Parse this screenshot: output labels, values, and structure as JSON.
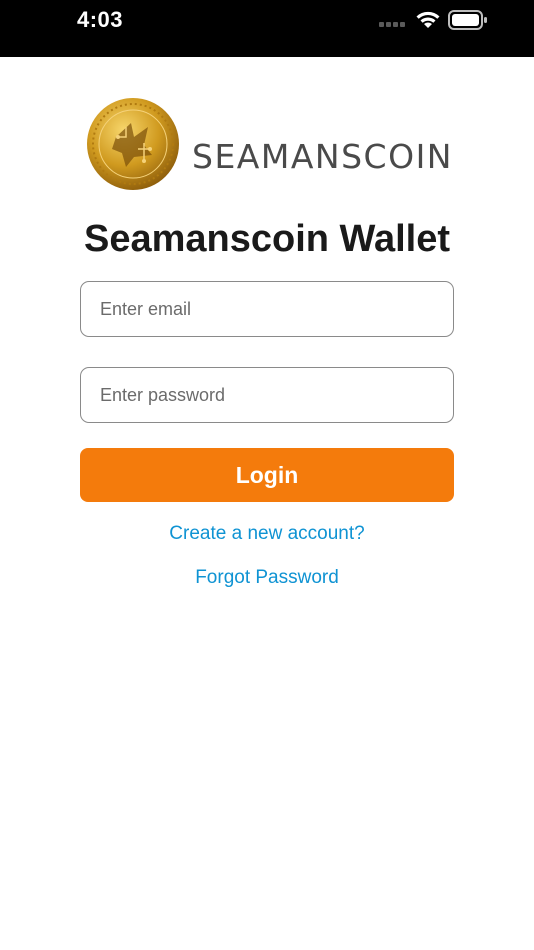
{
  "status_bar": {
    "time": "4:03",
    "icons": [
      "cellular-signal-icon",
      "wifi-icon",
      "battery-icon"
    ]
  },
  "logo": {
    "brand_text": "SEAMANSCOIN",
    "icon": "coin-logo-icon"
  },
  "login": {
    "title": "Seamanscoin Wallet",
    "email_placeholder": "Enter email",
    "email_value": "",
    "password_placeholder": "Enter password",
    "password_value": "",
    "login_label": "Login",
    "create_account_label": "Create a new account?",
    "forgot_password_label": "Forgot Password"
  },
  "colors": {
    "accent_orange": "#f47b0c",
    "link_blue": "#0f93d3",
    "status_bar_bg": "#000000",
    "gold": "#d4a020"
  }
}
